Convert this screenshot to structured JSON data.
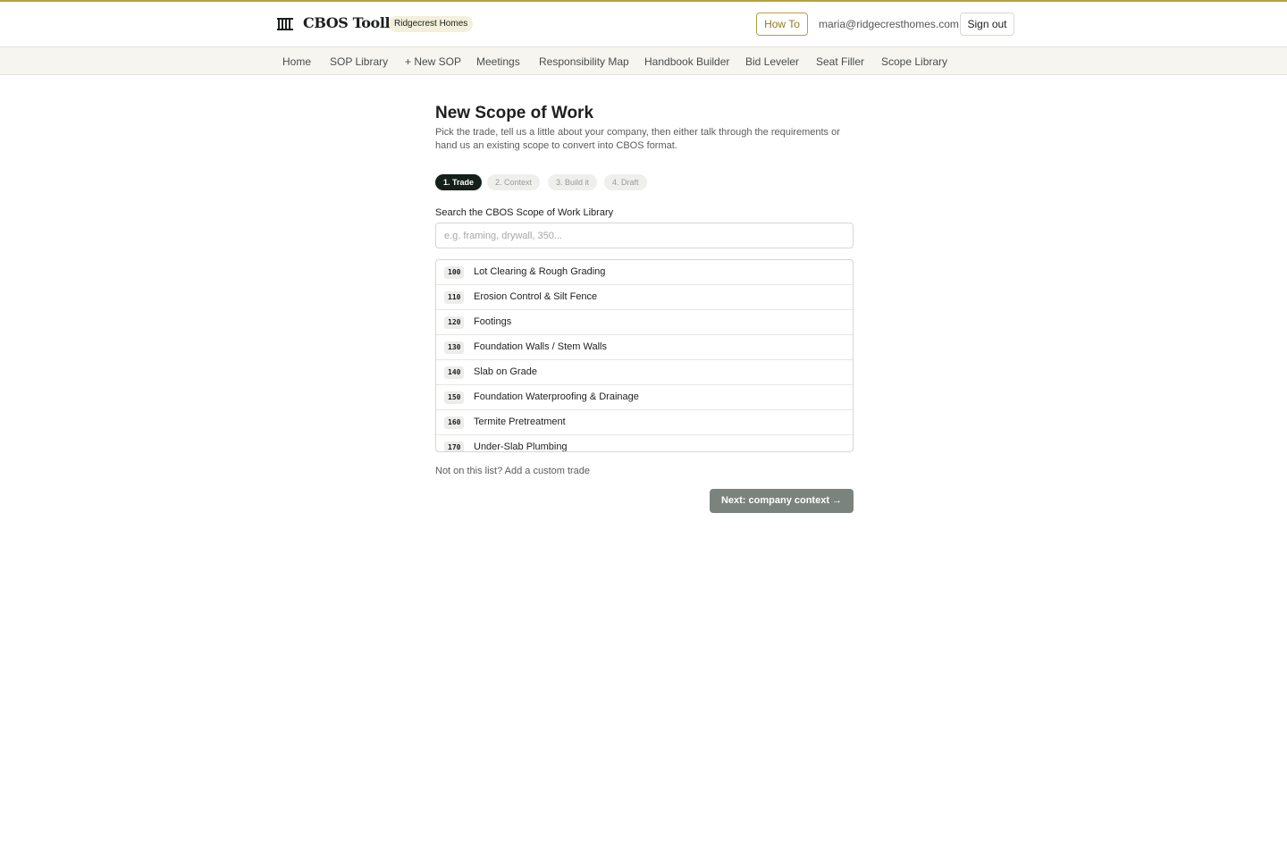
{
  "header": {
    "app_name": "CBOS Toolkit",
    "company": "Ridgecrest Homes",
    "howto_label": "How To",
    "user_email": "maria@ridgecresthomes.com",
    "signout_label": "Sign out",
    "accent_color": "#b8a03c"
  },
  "nav": {
    "items": [
      {
        "label": "Home"
      },
      {
        "label": "SOP Library"
      },
      {
        "label": "+ New SOP"
      },
      {
        "label": "Meetings"
      },
      {
        "label": "Responsibility Map"
      },
      {
        "label": "Handbook Builder"
      },
      {
        "label": "Bid Leveler"
      },
      {
        "label": "Seat Filler"
      },
      {
        "label": "Scope Library"
      }
    ]
  },
  "page": {
    "title": "New Scope of Work",
    "description": "Pick the trade, tell us a little about your company, then either talk through the requirements or hand us an existing scope to convert into CBOS format."
  },
  "steps": [
    {
      "label": "1. Trade",
      "active": true
    },
    {
      "label": "2. Context",
      "active": false
    },
    {
      "label": "3. Build it",
      "active": false
    },
    {
      "label": "4. Draft",
      "active": false
    }
  ],
  "search": {
    "label": "Search the CBOS Scope of Work Library",
    "placeholder": "e.g. framing, drywall, 350..."
  },
  "trades": [
    {
      "code": "100",
      "name": "Lot Clearing & Rough Grading"
    },
    {
      "code": "110",
      "name": "Erosion Control & Silt Fence"
    },
    {
      "code": "120",
      "name": "Footings"
    },
    {
      "code": "130",
      "name": "Foundation Walls / Stem Walls"
    },
    {
      "code": "140",
      "name": "Slab on Grade"
    },
    {
      "code": "150",
      "name": "Foundation Waterproofing & Drainage"
    },
    {
      "code": "160",
      "name": "Termite Pretreatment"
    },
    {
      "code": "170",
      "name": "Under-Slab Plumbing"
    }
  ],
  "custom_trade_label": "Not on this list? Add a custom trade",
  "next_button_label": "Next: company context →"
}
